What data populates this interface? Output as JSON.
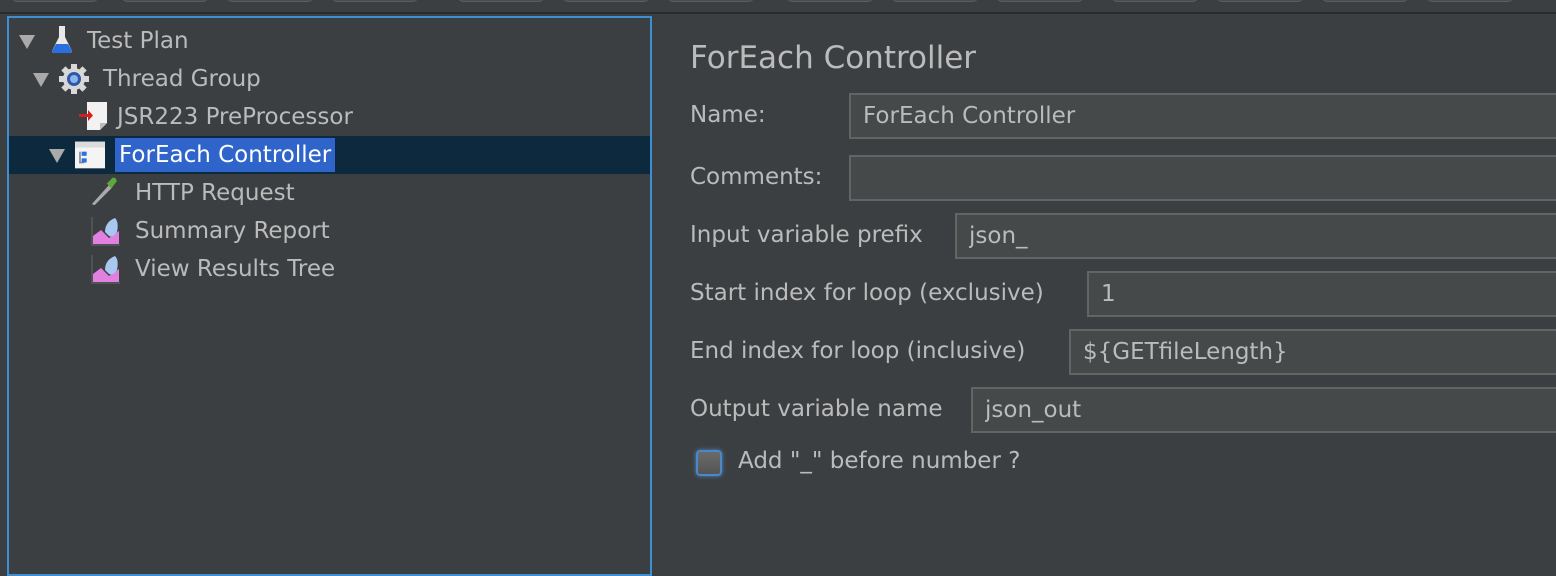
{
  "toolbar": {
    "buttons": [
      "toolbar-button",
      "toolbar-button",
      "toolbar-button",
      "toolbar-button",
      "toolbar-button",
      "toolbar-button",
      "toolbar-button",
      "toolbar-button",
      "toolbar-button",
      "toolbar-button",
      "toolbar-button",
      "toolbar-button",
      "toolbar-button",
      "toolbar-button"
    ]
  },
  "tree": {
    "nodes": [
      {
        "label": "Test Plan",
        "icon": "flask-icon",
        "expanded": true,
        "level": 0
      },
      {
        "label": "Thread Group",
        "icon": "gear-icon",
        "expanded": true,
        "level": 1
      },
      {
        "label": "JSR223 PreProcessor",
        "icon": "preprocessor-icon",
        "level": 2
      },
      {
        "label": "ForEach Controller",
        "icon": "foreach-controller-icon",
        "expanded": true,
        "selected": true,
        "level": 1
      },
      {
        "label": "HTTP Request",
        "icon": "pipette-icon",
        "level": 2
      },
      {
        "label": "Summary Report",
        "icon": "listener-chart-icon",
        "level": 2
      },
      {
        "label": "View Results Tree",
        "icon": "listener-chart-icon",
        "level": 2
      }
    ]
  },
  "editor": {
    "title": "ForEach Controller",
    "name_label": "Name:",
    "name_value": "ForEach Controller",
    "comments_label": "Comments:",
    "comments_value": "",
    "input_prefix_label": "Input variable prefix",
    "input_prefix_value": "json_",
    "start_index_label": "Start index for loop (exclusive)",
    "start_index_value": "1",
    "end_index_label": "End index for loop (inclusive)",
    "end_index_value": "${GETfileLength}",
    "output_var_label": "Output variable name",
    "output_var_value": "json_out",
    "add_underscore_label": "Add \"_\" before number ?",
    "add_underscore_checked": false
  },
  "colors": {
    "background": "#3c3f41",
    "selection": "#2f65ca",
    "selection_row": "#0d293e",
    "focus_border": "#3d8fd1",
    "text": "#bbbbbb"
  }
}
